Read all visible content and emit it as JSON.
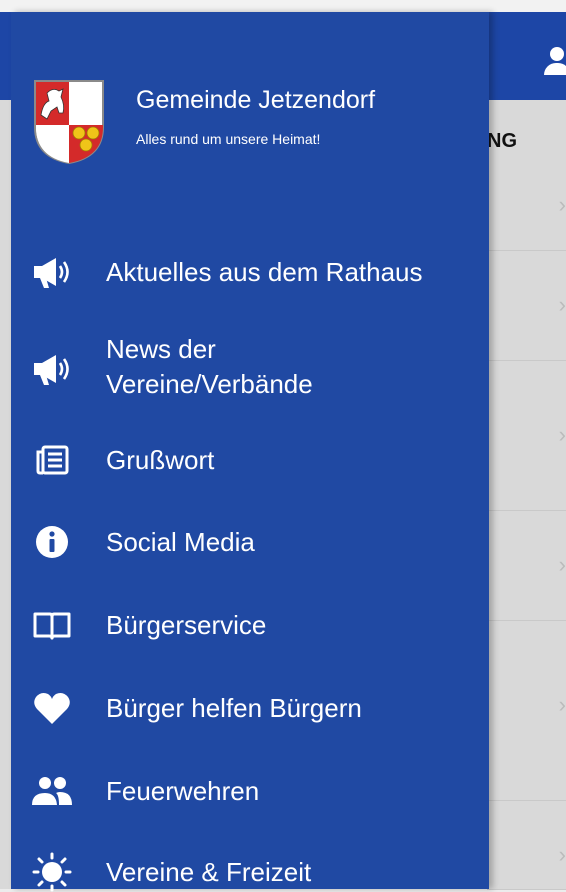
{
  "drawer": {
    "title": "Gemeinde Jetzendorf",
    "subtitle": "Alles rund um unsere Heimat!",
    "items": [
      {
        "label": "Aktuelles aus dem Rathaus",
        "icon": "megaphone-icon"
      },
      {
        "label_line1": "News der",
        "label_line2": "Vereine/Verbände",
        "icon": "megaphone-icon"
      },
      {
        "label": "Grußwort",
        "icon": "newspaper-icon"
      },
      {
        "label": "Social Media",
        "icon": "info-icon"
      },
      {
        "label": "Bürgerservice",
        "icon": "book-icon"
      },
      {
        "label": "Bürger helfen Bürgern",
        "icon": "heart-icon"
      },
      {
        "label": "Feuerwehren",
        "icon": "group-icon"
      },
      {
        "label": "Vereine & Freizeit",
        "icon": "sun-icon"
      }
    ]
  },
  "background": {
    "tab_label_fragment": "NG"
  },
  "colors": {
    "drawer": "#2049a3",
    "header": "#1d46a6",
    "background": "#d9d9d9"
  }
}
